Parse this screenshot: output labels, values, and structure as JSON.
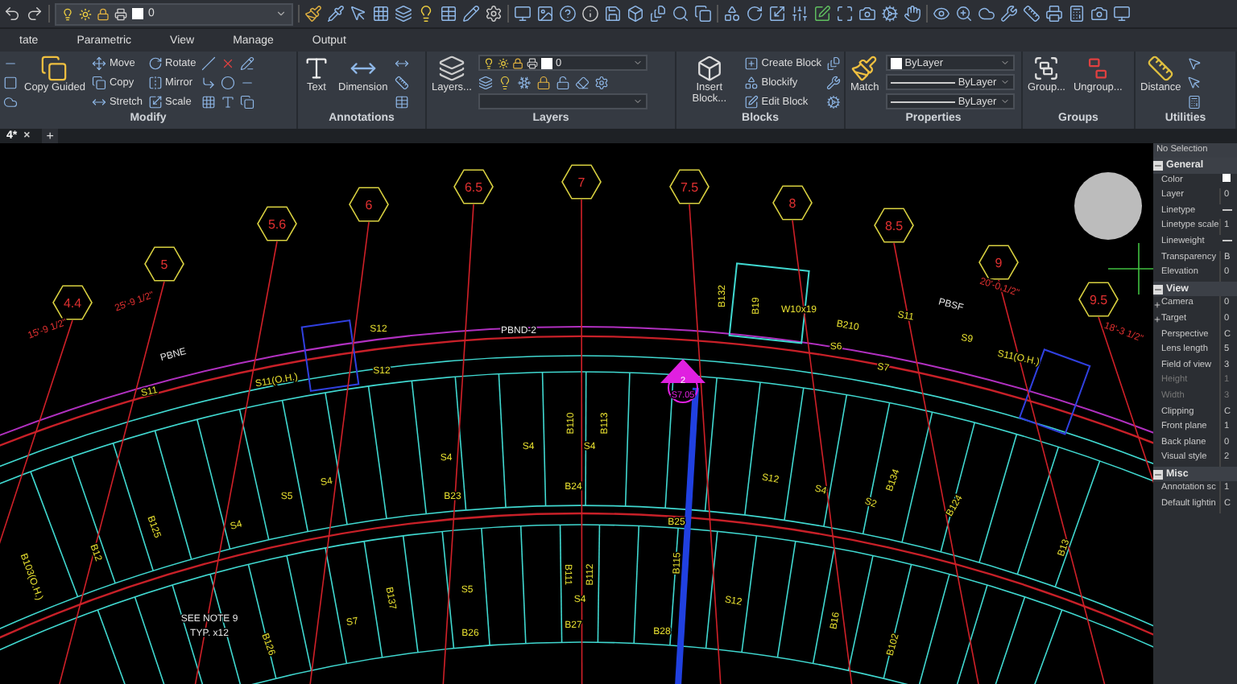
{
  "quick_access": {
    "layer": "0"
  },
  "tabs": [
    {
      "label": "tate",
      "selected": false
    },
    {
      "label": "Parametric",
      "selected": false
    },
    {
      "label": "View",
      "selected": false
    },
    {
      "label": "Manage",
      "selected": false
    },
    {
      "label": "Output",
      "selected": false
    }
  ],
  "ribbon": {
    "panels": [
      {
        "title": "Modify",
        "tools": [
          {
            "kind": "icon"
          },
          {
            "kind": "icon"
          },
          {
            "kind": "icon"
          },
          {
            "kind": "large",
            "label": "Copy Guided"
          },
          {
            "kind": "small",
            "label": "Move"
          },
          {
            "kind": "small",
            "label": "Copy"
          },
          {
            "kind": "small",
            "label": "Stretch"
          },
          {
            "kind": "small",
            "label": "Rotate"
          },
          {
            "kind": "small",
            "label": "Mirror"
          },
          {
            "kind": "small",
            "label": "Scale"
          },
          {
            "kind": "icon"
          },
          {
            "kind": "icon"
          },
          {
            "kind": "icon"
          },
          {
            "kind": "icon"
          },
          {
            "kind": "icon"
          },
          {
            "kind": "icon"
          },
          {
            "kind": "icon"
          },
          {
            "kind": "icon"
          },
          {
            "kind": "icon"
          }
        ]
      },
      {
        "title": "Annotations",
        "tools": [
          {
            "kind": "large",
            "label": "Text"
          },
          {
            "kind": "large",
            "label": "Dimension"
          },
          {
            "kind": "icon"
          },
          {
            "kind": "icon"
          },
          {
            "kind": "icon"
          }
        ]
      },
      {
        "title": "Layers",
        "tools": [
          {
            "kind": "large",
            "label": "Layers..."
          },
          {
            "kind": "layer-dropdown",
            "value": "0"
          },
          {
            "kind": "icon"
          },
          {
            "kind": "icon"
          },
          {
            "kind": "icon"
          },
          {
            "kind": "icon"
          },
          {
            "kind": "icon"
          },
          {
            "kind": "icon"
          },
          {
            "kind": "icon"
          },
          {
            "kind": "dropdown"
          }
        ]
      },
      {
        "title": "Blocks",
        "tools": [
          {
            "kind": "large",
            "label": "Insert Block..."
          },
          {
            "kind": "small",
            "label": "Create Block"
          },
          {
            "kind": "small",
            "label": "Blockify"
          },
          {
            "kind": "small",
            "label": "Edit Block"
          },
          {
            "kind": "icon"
          },
          {
            "kind": "icon"
          },
          {
            "kind": "icon"
          }
        ]
      },
      {
        "title": "Properties",
        "tools": [
          {
            "kind": "large",
            "label": "Match"
          },
          {
            "kind": "color-dropdown",
            "value": "ByLayer"
          },
          {
            "kind": "line-dropdown",
            "value": "ByLayer"
          },
          {
            "kind": "line-dropdown",
            "value": "ByLayer"
          }
        ]
      },
      {
        "title": "Groups",
        "tools": [
          {
            "kind": "large",
            "label": "Group..."
          },
          {
            "kind": "large",
            "label": "Ungroup..."
          }
        ]
      },
      {
        "title": "Utilities",
        "tools": [
          {
            "kind": "large",
            "label": "Distance"
          },
          {
            "kind": "icon"
          },
          {
            "kind": "icon"
          },
          {
            "kind": "icon"
          }
        ]
      }
    ]
  },
  "document_tabs": [
    {
      "label": "4*",
      "close": "×",
      "selected": true
    }
  ],
  "new_tab": "+",
  "drawing": {
    "grid_bubbles": [
      {
        "label": "4.4"
      },
      {
        "label": "5"
      },
      {
        "label": "5.6"
      },
      {
        "label": "6"
      },
      {
        "label": "6.5"
      },
      {
        "label": "7"
      },
      {
        "label": "7.5"
      },
      {
        "label": "8"
      },
      {
        "label": "8.5"
      },
      {
        "label": "9"
      },
      {
        "label": "9.5"
      }
    ],
    "section_markers": [
      {
        "number": "2",
        "sheet": "S7.05"
      }
    ],
    "labels": [
      {
        "text": "PBNE",
        "kind": "line-name"
      },
      {
        "text": "PBND-2",
        "kind": "line-name"
      },
      {
        "text": "PBSF",
        "kind": "line-name"
      },
      {
        "text": "S12",
        "kind": "slab"
      },
      {
        "text": "S12",
        "kind": "slab"
      },
      {
        "text": "S11",
        "kind": "slab"
      },
      {
        "text": "S11(O.H.)",
        "kind": "slab"
      },
      {
        "text": "S11",
        "kind": "slab"
      },
      {
        "text": "S9",
        "kind": "slab"
      },
      {
        "text": "S11(O.H.)",
        "kind": "slab"
      },
      {
        "text": "S6",
        "kind": "slab"
      },
      {
        "text": "S7",
        "kind": "slab"
      },
      {
        "text": "W10x19",
        "kind": "beam"
      },
      {
        "text": "B210",
        "kind": "beam"
      },
      {
        "text": "B132",
        "kind": "beam"
      },
      {
        "text": "B19",
        "kind": "beam"
      },
      {
        "text": "S4",
        "kind": "slab"
      },
      {
        "text": "S4",
        "kind": "slab"
      },
      {
        "text": "S4",
        "kind": "slab"
      },
      {
        "text": "S4",
        "kind": "slab"
      },
      {
        "text": "S4",
        "kind": "slab"
      },
      {
        "text": "S4",
        "kind": "slab"
      },
      {
        "text": "S5",
        "kind": "slab"
      },
      {
        "text": "S5",
        "kind": "slab"
      },
      {
        "text": "S7",
        "kind": "slab"
      },
      {
        "text": "S12",
        "kind": "slab"
      },
      {
        "text": "S4",
        "kind": "slab"
      },
      {
        "text": "S2",
        "kind": "slab"
      },
      {
        "text": "S12",
        "kind": "slab"
      },
      {
        "text": "B23",
        "kind": "beam"
      },
      {
        "text": "B24",
        "kind": "beam"
      },
      {
        "text": "B25",
        "kind": "beam"
      },
      {
        "text": "B26",
        "kind": "beam"
      },
      {
        "text": "B27",
        "kind": "beam"
      },
      {
        "text": "B28",
        "kind": "beam"
      },
      {
        "text": "B124",
        "kind": "beam"
      },
      {
        "text": "B134",
        "kind": "beam"
      },
      {
        "text": "B12",
        "kind": "beam"
      },
      {
        "text": "B125",
        "kind": "beam"
      },
      {
        "text": "B126",
        "kind": "beam"
      },
      {
        "text": "B102",
        "kind": "beam"
      },
      {
        "text": "B137",
        "kind": "beam"
      },
      {
        "text": "B112",
        "kind": "beam"
      },
      {
        "text": "B111",
        "kind": "beam"
      },
      {
        "text": "B115",
        "kind": "beam"
      },
      {
        "text": "B16",
        "kind": "beam"
      },
      {
        "text": "B103(O.H.)",
        "kind": "beam"
      },
      {
        "text": "SEE NOTE 9",
        "kind": "note"
      },
      {
        "text": "TYP. x12",
        "kind": "note"
      },
      {
        "text": "15'-9 1/2\"",
        "kind": "dimension"
      },
      {
        "text": "25'-9 1/2\"",
        "kind": "dimension"
      },
      {
        "text": "20'-0 1/2\"",
        "kind": "dimension"
      },
      {
        "text": "18'-3 1/2\"",
        "kind": "dimension"
      },
      {
        "text": "B110",
        "kind": "beam"
      },
      {
        "text": "B113",
        "kind": "beam"
      },
      {
        "text": "B13",
        "kind": "beam"
      }
    ]
  },
  "properties_panel": {
    "selection": "No Selection",
    "sections": [
      {
        "title": "General",
        "expanded": true,
        "rows": [
          {
            "label": "Color",
            "kind": "swatch",
            "disabled": false
          },
          {
            "label": "Layer",
            "value": "0",
            "kind": "text",
            "disabled": false
          },
          {
            "label": "Linetype",
            "kind": "line",
            "disabled": false
          },
          {
            "label": "Linetype scale",
            "value": "1",
            "kind": "text",
            "disabled": false
          },
          {
            "label": "Lineweight",
            "kind": "line",
            "disabled": false
          },
          {
            "label": "Transparency",
            "value": "B",
            "kind": "text",
            "disabled": false
          },
          {
            "label": "Elevation",
            "value": "0",
            "kind": "text",
            "disabled": false
          }
        ]
      },
      {
        "title": "View",
        "expanded": true,
        "rows": [
          {
            "label": "Camera",
            "value": "0",
            "kind": "expandable",
            "disabled": false
          },
          {
            "label": "Target",
            "value": "0",
            "kind": "expandable",
            "disabled": false
          },
          {
            "label": "Perspective",
            "value": "C",
            "kind": "text",
            "disabled": false
          },
          {
            "label": "Lens length",
            "value": "5",
            "kind": "text",
            "disabled": false
          },
          {
            "label": "Field of view",
            "value": "3",
            "kind": "text",
            "disabled": false
          },
          {
            "label": "Height",
            "value": "1",
            "kind": "text",
            "disabled": true
          },
          {
            "label": "Width",
            "value": "3",
            "kind": "text",
            "disabled": true
          },
          {
            "label": "Clipping",
            "value": "C",
            "kind": "text",
            "disabled": false
          },
          {
            "label": "Front plane",
            "value": "1",
            "kind": "text",
            "disabled": false
          },
          {
            "label": "Back plane",
            "value": "0",
            "kind": "text",
            "disabled": false
          },
          {
            "label": "Visual style",
            "value": "2",
            "kind": "text",
            "disabled": false
          }
        ]
      },
      {
        "title": "Misc",
        "expanded": true,
        "rows": [
          {
            "label": "Annotation sc",
            "value": "1",
            "kind": "text",
            "disabled": false
          },
          {
            "label": "Default lightin",
            "value": "C",
            "kind": "text",
            "disabled": false
          }
        ]
      }
    ]
  }
}
